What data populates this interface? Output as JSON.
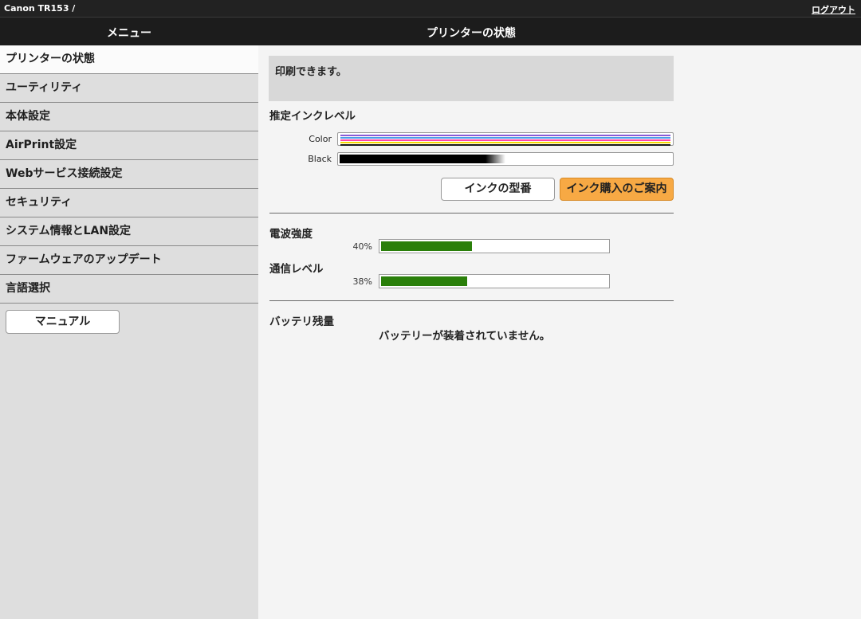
{
  "top": {
    "device": "Canon TR153 /",
    "logout": "ログアウト"
  },
  "header": {
    "menu_title": "メニュー",
    "page_title": "プリンターの状態"
  },
  "sidebar": {
    "items": [
      {
        "label": "プリンターの状態",
        "active": true
      },
      {
        "label": "ユーティリティ"
      },
      {
        "label": "本体設定"
      },
      {
        "label": "AirPrint設定"
      },
      {
        "label": "Webサービス接続設定"
      },
      {
        "label": "セキュリティ"
      },
      {
        "label": "システム情報とLAN設定"
      },
      {
        "label": "ファームウェアのアップデート"
      },
      {
        "label": "言語選択"
      }
    ],
    "manual_button": "マニュアル"
  },
  "status": {
    "message": "印刷できます。"
  },
  "ink": {
    "title": "推定インクレベル",
    "color_label": "Color",
    "black_label": "Black",
    "black_level": 0.5,
    "color_stripe_colors": [
      "#8a5bd6",
      "#4a9be8",
      "#ff44aa",
      "#f5d800",
      "#1a1a1a"
    ],
    "black_color": "#000000",
    "model_button": "インクの型番",
    "purchase_button": "インク購入のご案内"
  },
  "signal": {
    "strength_title": "電波強度",
    "strength_pct": "40%",
    "strength_value": 0.4,
    "comm_title": "通信レベル",
    "comm_pct": "38%",
    "comm_value": 0.38,
    "bar_color": "#2a7f0a"
  },
  "battery": {
    "title": "バッテリ残量",
    "message": "バッテリーが装着されていません。"
  },
  "colors": {
    "accent_orange": "#f7a944",
    "divider": "#6a6a6a"
  }
}
